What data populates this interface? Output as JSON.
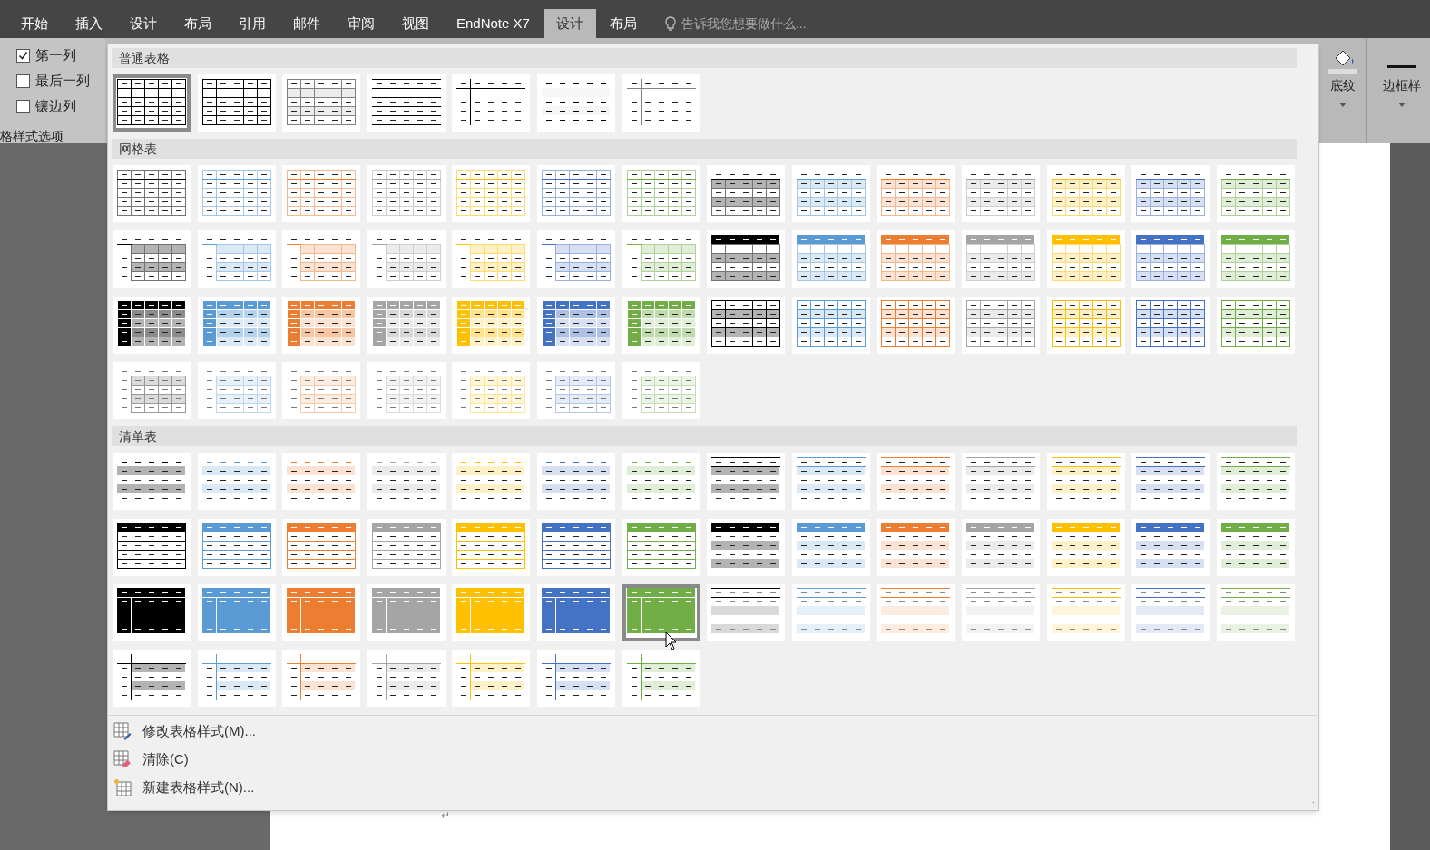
{
  "ribbon_tabs": [
    {
      "label": "开始",
      "selected": false
    },
    {
      "label": "插入",
      "selected": false
    },
    {
      "label": "设计",
      "selected": false
    },
    {
      "label": "布局",
      "selected": false
    },
    {
      "label": "引用",
      "selected": false
    },
    {
      "label": "邮件",
      "selected": false
    },
    {
      "label": "审阅",
      "selected": false
    },
    {
      "label": "视图",
      "selected": false
    },
    {
      "label": "EndNote X7",
      "selected": false
    },
    {
      "label": "设计",
      "selected": true
    },
    {
      "label": "布局",
      "selected": false
    }
  ],
  "tell_me": {
    "placeholder": "告诉我您想要做什么..."
  },
  "style_options": {
    "checkboxes": [
      {
        "label": "第一列",
        "checked": true
      },
      {
        "label": "最后一列",
        "checked": false
      },
      {
        "label": "镶边列",
        "checked": false
      }
    ],
    "group_label": "格样式选项"
  },
  "ribbon_right": [
    {
      "label": "底纹"
    },
    {
      "label": "边框样"
    }
  ],
  "gallery": {
    "sections": [
      {
        "title": "普通表格",
        "styles": [
          {
            "kind": "grid-bold",
            "color": "#000000",
            "selected": true
          },
          {
            "kind": "grid",
            "color": "#000000",
            "selected": false
          },
          {
            "kind": "grid-light",
            "color": "#808080",
            "selected": false
          },
          {
            "kind": "rules",
            "color": "#000000",
            "selected": false
          },
          {
            "kind": "corner-lines",
            "color": "#000000",
            "selected": false
          },
          {
            "kind": "dashes",
            "color": "#000000",
            "selected": false
          },
          {
            "kind": "corner-lines",
            "color": "#808080",
            "selected": false
          }
        ]
      },
      {
        "title": "网格表",
        "styles": [
          {
            "kind": "grid-header",
            "color": "#000000",
            "selected": false
          },
          {
            "kind": "grid-header",
            "color": "#5b9bd5",
            "selected": false
          },
          {
            "kind": "grid-header",
            "color": "#ed7d31",
            "selected": false
          },
          {
            "kind": "grid-header",
            "color": "#a5a5a5",
            "selected": false
          },
          {
            "kind": "grid-header",
            "color": "#ffc000",
            "selected": false
          },
          {
            "kind": "grid-header",
            "color": "#4472c4",
            "selected": false
          },
          {
            "kind": "grid-header",
            "color": "#70ad47",
            "selected": false
          },
          {
            "kind": "grid-banded",
            "color": "#000000",
            "selected": false
          },
          {
            "kind": "grid-banded",
            "color": "#5b9bd5",
            "selected": false
          },
          {
            "kind": "grid-banded",
            "color": "#ed7d31",
            "selected": false
          },
          {
            "kind": "grid-banded",
            "color": "#a5a5a5",
            "selected": false
          },
          {
            "kind": "grid-banded",
            "color": "#ffc000",
            "selected": false
          },
          {
            "kind": "grid-banded",
            "color": "#4472c4",
            "selected": false
          },
          {
            "kind": "grid-banded",
            "color": "#70ad47",
            "selected": false
          },
          {
            "kind": "grid-open",
            "color": "#000000",
            "selected": false
          },
          {
            "kind": "grid-open",
            "color": "#5b9bd5",
            "selected": false
          },
          {
            "kind": "grid-open",
            "color": "#ed7d31",
            "selected": false
          },
          {
            "kind": "grid-open",
            "color": "#a5a5a5",
            "selected": false
          },
          {
            "kind": "grid-open",
            "color": "#ffc000",
            "selected": false
          },
          {
            "kind": "grid-open",
            "color": "#4472c4",
            "selected": false
          },
          {
            "kind": "grid-open",
            "color": "#70ad47",
            "selected": false
          },
          {
            "kind": "grid-header-fill",
            "color": "#000000",
            "selected": false
          },
          {
            "kind": "grid-header-fill",
            "color": "#5b9bd5",
            "selected": false
          },
          {
            "kind": "grid-header-fill",
            "color": "#ed7d31",
            "selected": false
          },
          {
            "kind": "grid-header-fill",
            "color": "#a5a5a5",
            "selected": false
          },
          {
            "kind": "grid-header-fill",
            "color": "#ffc000",
            "selected": false
          },
          {
            "kind": "grid-header-fill",
            "color": "#4472c4",
            "selected": false
          },
          {
            "kind": "grid-header-fill",
            "color": "#70ad47",
            "selected": false
          },
          {
            "kind": "grid-accent",
            "color": "#000000",
            "selected": false
          },
          {
            "kind": "grid-accent",
            "color": "#5b9bd5",
            "selected": false
          },
          {
            "kind": "grid-accent",
            "color": "#ed7d31",
            "selected": false
          },
          {
            "kind": "grid-accent",
            "color": "#a5a5a5",
            "selected": false
          },
          {
            "kind": "grid-accent",
            "color": "#ffc000",
            "selected": false
          },
          {
            "kind": "grid-accent",
            "color": "#4472c4",
            "selected": false
          },
          {
            "kind": "grid-accent",
            "color": "#70ad47",
            "selected": false
          },
          {
            "kind": "grid-light-banded",
            "color": "#000000",
            "selected": false
          },
          {
            "kind": "grid-light-banded",
            "color": "#5b9bd5",
            "selected": false
          },
          {
            "kind": "grid-light-banded",
            "color": "#ed7d31",
            "selected": false
          },
          {
            "kind": "grid-light-banded",
            "color": "#a5a5a5",
            "selected": false
          },
          {
            "kind": "grid-light-banded",
            "color": "#ffc000",
            "selected": false
          },
          {
            "kind": "grid-light-banded",
            "color": "#4472c4",
            "selected": false
          },
          {
            "kind": "grid-light-banded",
            "color": "#70ad47",
            "selected": false
          },
          {
            "kind": "grid-open-light",
            "color": "#000000",
            "selected": false
          },
          {
            "kind": "grid-open-light",
            "color": "#5b9bd5",
            "selected": false
          },
          {
            "kind": "grid-open-light",
            "color": "#ed7d31",
            "selected": false
          },
          {
            "kind": "grid-open-light",
            "color": "#a5a5a5",
            "selected": false
          },
          {
            "kind": "grid-open-light",
            "color": "#ffc000",
            "selected": false
          },
          {
            "kind": "grid-open-light",
            "color": "#4472c4",
            "selected": false
          },
          {
            "kind": "grid-open-light",
            "color": "#70ad47",
            "selected": false
          }
        ]
      },
      {
        "title": "清单表",
        "styles": [
          {
            "kind": "list-banded",
            "color": "#000000",
            "selected": false
          },
          {
            "kind": "list-banded",
            "color": "#5b9bd5",
            "selected": false
          },
          {
            "kind": "list-banded",
            "color": "#ed7d31",
            "selected": false
          },
          {
            "kind": "list-banded",
            "color": "#a5a5a5",
            "selected": false
          },
          {
            "kind": "list-banded",
            "color": "#ffc000",
            "selected": false
          },
          {
            "kind": "list-banded",
            "color": "#4472c4",
            "selected": false
          },
          {
            "kind": "list-banded",
            "color": "#70ad47",
            "selected": false
          },
          {
            "kind": "list-rules",
            "color": "#000000",
            "selected": false
          },
          {
            "kind": "list-rules",
            "color": "#5b9bd5",
            "selected": false
          },
          {
            "kind": "list-rules",
            "color": "#ed7d31",
            "selected": false
          },
          {
            "kind": "list-rules",
            "color": "#a5a5a5",
            "selected": false
          },
          {
            "kind": "list-rules",
            "color": "#ffc000",
            "selected": false
          },
          {
            "kind": "list-rules",
            "color": "#4472c4",
            "selected": false
          },
          {
            "kind": "list-rules",
            "color": "#70ad47",
            "selected": false
          },
          {
            "kind": "list-header-box",
            "color": "#000000",
            "selected": false
          },
          {
            "kind": "list-header-box",
            "color": "#5b9bd5",
            "selected": false
          },
          {
            "kind": "list-header-box",
            "color": "#ed7d31",
            "selected": false
          },
          {
            "kind": "list-header-box",
            "color": "#a5a5a5",
            "selected": false
          },
          {
            "kind": "list-header-box",
            "color": "#ffc000",
            "selected": false
          },
          {
            "kind": "list-header-box",
            "color": "#4472c4",
            "selected": false
          },
          {
            "kind": "list-header-box",
            "color": "#70ad47",
            "selected": false
          },
          {
            "kind": "list-header-banded",
            "color": "#000000",
            "selected": false
          },
          {
            "kind": "list-header-banded",
            "color": "#5b9bd5",
            "selected": false
          },
          {
            "kind": "list-header-banded",
            "color": "#ed7d31",
            "selected": false
          },
          {
            "kind": "list-header-banded",
            "color": "#a5a5a5",
            "selected": false
          },
          {
            "kind": "list-header-banded",
            "color": "#ffc000",
            "selected": false
          },
          {
            "kind": "list-header-banded",
            "color": "#4472c4",
            "selected": false
          },
          {
            "kind": "list-header-banded",
            "color": "#70ad47",
            "selected": false
          },
          {
            "kind": "list-filled",
            "color": "#000000",
            "selected": false
          },
          {
            "kind": "list-filled",
            "color": "#5b9bd5",
            "selected": false
          },
          {
            "kind": "list-filled",
            "color": "#ed7d31",
            "selected": false
          },
          {
            "kind": "list-filled",
            "color": "#a5a5a5",
            "selected": false
          },
          {
            "kind": "list-filled",
            "color": "#ffc000",
            "selected": false
          },
          {
            "kind": "list-filled",
            "color": "#4472c4",
            "selected": false
          },
          {
            "kind": "list-filled",
            "color": "#70ad47",
            "selected": true
          },
          {
            "kind": "list-light-rules",
            "color": "#000000",
            "selected": false
          },
          {
            "kind": "list-light-rules",
            "color": "#5b9bd5",
            "selected": false
          },
          {
            "kind": "list-light-rules",
            "color": "#ed7d31",
            "selected": false
          },
          {
            "kind": "list-light-rules",
            "color": "#a5a5a5",
            "selected": false
          },
          {
            "kind": "list-light-rules",
            "color": "#ffc000",
            "selected": false
          },
          {
            "kind": "list-light-rules",
            "color": "#4472c4",
            "selected": false
          },
          {
            "kind": "list-light-rules",
            "color": "#70ad47",
            "selected": false
          },
          {
            "kind": "list-first-col",
            "color": "#000000",
            "selected": false
          },
          {
            "kind": "list-first-col",
            "color": "#5b9bd5",
            "selected": false
          },
          {
            "kind": "list-first-col",
            "color": "#ed7d31",
            "selected": false
          },
          {
            "kind": "list-first-col",
            "color": "#a5a5a5",
            "selected": false
          },
          {
            "kind": "list-first-col",
            "color": "#ffc000",
            "selected": false
          },
          {
            "kind": "list-first-col",
            "color": "#4472c4",
            "selected": false
          },
          {
            "kind": "list-first-col",
            "color": "#70ad47",
            "selected": false
          }
        ]
      }
    ],
    "menu_items": [
      {
        "kind": "modify",
        "label": "修改表格样式(M)..."
      },
      {
        "kind": "clear",
        "label": "清除(C)"
      },
      {
        "kind": "new",
        "label": "新建表格样式(N)..."
      }
    ]
  },
  "paragraph_mark": "↵"
}
